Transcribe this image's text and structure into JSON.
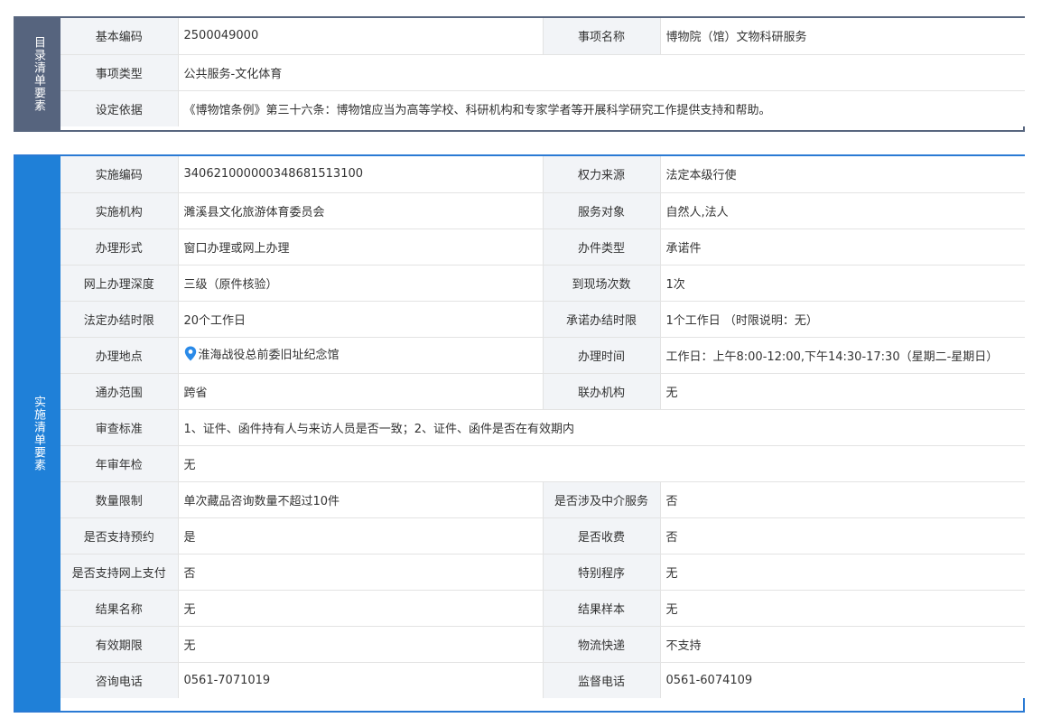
{
  "catalog": {
    "title": "目录清单要素",
    "basic_code_label": "基本编码",
    "basic_code_value": "2500049000",
    "item_name_label": "事项名称",
    "item_name_value": "博物院（馆）文物科研服务",
    "item_type_label": "事项类型",
    "item_type_value": "公共服务-文化体育",
    "basis_label": "设定依据",
    "basis_value": "《博物馆条例》第三十六条：博物馆应当为高等学校、科研机构和专家学者等开展科学研究工作提供支持和帮助。"
  },
  "implement": {
    "title": "实施清单要素",
    "impl_code_label": "实施编码",
    "impl_code_value": "340621000000348681513100",
    "power_source_label": "权力来源",
    "power_source_value": "法定本级行使",
    "agency_label": "实施机构",
    "agency_value": "濉溪县文化旅游体育委员会",
    "service_target_label": "服务对象",
    "service_target_value": "自然人,法人",
    "handle_form_label": "办理形式",
    "handle_form_value": "窗口办理或网上办理",
    "case_type_label": "办件类型",
    "case_type_value": "承诺件",
    "online_depth_label": "网上办理深度",
    "online_depth_value": "三级（原件核验）",
    "visits_label": "到现场次数",
    "visits_value": "1次",
    "legal_limit_label": "法定办结时限",
    "legal_limit_value": "20个工作日",
    "promise_limit_label": "承诺办结时限",
    "promise_limit_value": "1个工作日 （时限说明：无）",
    "location_label": "办理地点",
    "location_value": "淮海战役总前委旧址纪念馆",
    "location_icon": "location-pin-icon",
    "hours_label": "办理时间",
    "hours_value": "工作日：上午8:00-12:00,下午14:30-17:30（星期二-星期日）",
    "scope_label": "通办范围",
    "scope_value": "跨省",
    "joint_agency_label": "联办机构",
    "joint_agency_value": "无",
    "review_standard_label": "审查标准",
    "review_standard_value": "1、证件、函件持有人与来访人员是否一致；2、证件、函件是否在有效期内",
    "annual_review_label": "年审年检",
    "annual_review_value": "无",
    "quantity_limit_label": "数量限制",
    "quantity_limit_value": "单次藏品咨询数量不超过10件",
    "intermediary_label": "是否涉及中介服务",
    "intermediary_value": "否",
    "reservation_label": "是否支持预约",
    "reservation_value": "是",
    "fee_label": "是否收费",
    "fee_value": "否",
    "online_pay_label": "是否支持网上支付",
    "online_pay_value": "否",
    "special_procedure_label": "特别程序",
    "special_procedure_value": "无",
    "result_name_label": "结果名称",
    "result_name_value": "无",
    "result_sample_label": "结果样本",
    "result_sample_value": "无",
    "validity_label": "有效期限",
    "validity_value": "无",
    "logistics_label": "物流快递",
    "logistics_value": "不支持",
    "consult_phone_label": "咨询电话",
    "consult_phone_value": "0561-7071019",
    "supervise_phone_label": "监督电话",
    "supervise_phone_value": "0561-6074109"
  },
  "colors": {
    "catalog_side": "#56647e",
    "implement_side": "#1f80d8",
    "label_bg": "#f2f4f7",
    "pin": "#2a8ae8"
  }
}
